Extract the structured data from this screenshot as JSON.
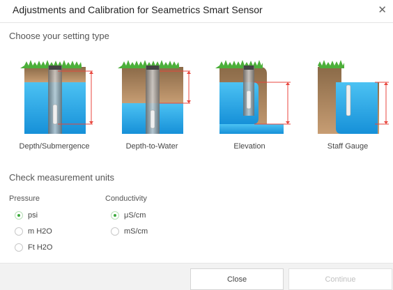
{
  "dialog": {
    "title": "Adjustments and Calibration for Seametrics Smart Sensor",
    "close_icon": "close-icon"
  },
  "setting_type": {
    "heading": "Choose your setting type",
    "options": [
      {
        "label": "Depth/Submergence"
      },
      {
        "label": "Depth-to-Water"
      },
      {
        "label": "Elevation"
      },
      {
        "label": "Staff Gauge"
      }
    ]
  },
  "units": {
    "heading": "Check measurement units",
    "pressure": {
      "label": "Pressure",
      "options": [
        {
          "label": "psi",
          "selected": true
        },
        {
          "label": "m H2O",
          "selected": false
        },
        {
          "label": "Ft H2O",
          "selected": false
        }
      ]
    },
    "conductivity": {
      "label": "Conductivity",
      "options": [
        {
          "label": "μS/cm",
          "selected": true
        },
        {
          "label": "mS/cm",
          "selected": false
        }
      ]
    }
  },
  "footer": {
    "close_label": "Close",
    "continue_label": "Continue"
  },
  "colors": {
    "accent_green": "#3caa3c",
    "water_blue": "#1aa3e6",
    "marker_red": "#e8453c"
  }
}
